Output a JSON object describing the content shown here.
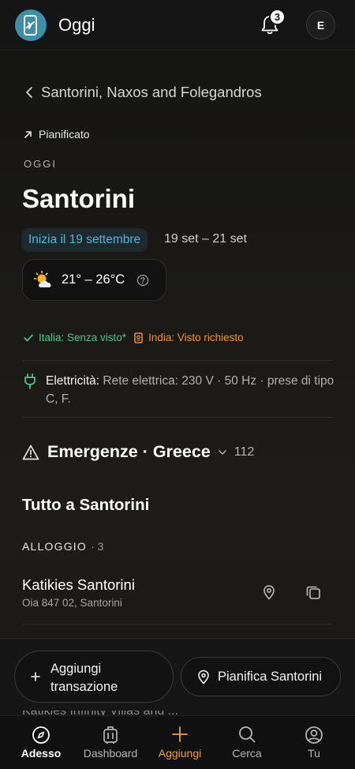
{
  "header": {
    "title": "Oggi",
    "notification_count": "3",
    "avatar_initial": "E"
  },
  "trip": {
    "back_label": "Santorini, Naxos and Folegandros"
  },
  "status": {
    "label": "Pianificato"
  },
  "section": {
    "today_label": "OGGI",
    "city": "Santorini"
  },
  "dates": {
    "start_chip": "Inizia il 19 settembre",
    "range": "19 set – 21 set"
  },
  "weather": {
    "temp_range": "21° – 26°C",
    "icon": "partly-sunny-icon"
  },
  "visa": {
    "italy": "Italia: Senza visto*",
    "india": "India: Visto richiesto"
  },
  "electricity": {
    "label": "Elettricità:",
    "details": "Rete elettrica: 230 V · 50 Hz · prese di tipo C, F."
  },
  "emergency": {
    "title": "Emergenze · Greece",
    "number": "112"
  },
  "all_in": {
    "title": "Tutto a Santorini"
  },
  "accommodation": {
    "label": "ALLOGGIO",
    "count": "· 3",
    "items": [
      {
        "name": "Katikies Santorini",
        "address": "Oia 847 02, Santorini"
      }
    ]
  },
  "peek_text": "Katikies Infinity Villas and ...",
  "actions": {
    "add_transaction": "Aggiungi transazione",
    "plan_city": "Pianifica Santorini"
  },
  "nav": {
    "items": [
      {
        "label": "Adesso",
        "icon": "compass-icon"
      },
      {
        "label": "Dashboard",
        "icon": "luggage-icon"
      },
      {
        "label": "Aggiungi",
        "icon": "plus-icon"
      },
      {
        "label": "Cerca",
        "icon": "search-icon"
      },
      {
        "label": "Tu",
        "icon": "user-icon"
      }
    ]
  },
  "colors": {
    "accent_blue": "#4ab7df",
    "accent_orange": "#e8a24a",
    "green": "#4fc48a",
    "logo": "#3d8fa8"
  }
}
